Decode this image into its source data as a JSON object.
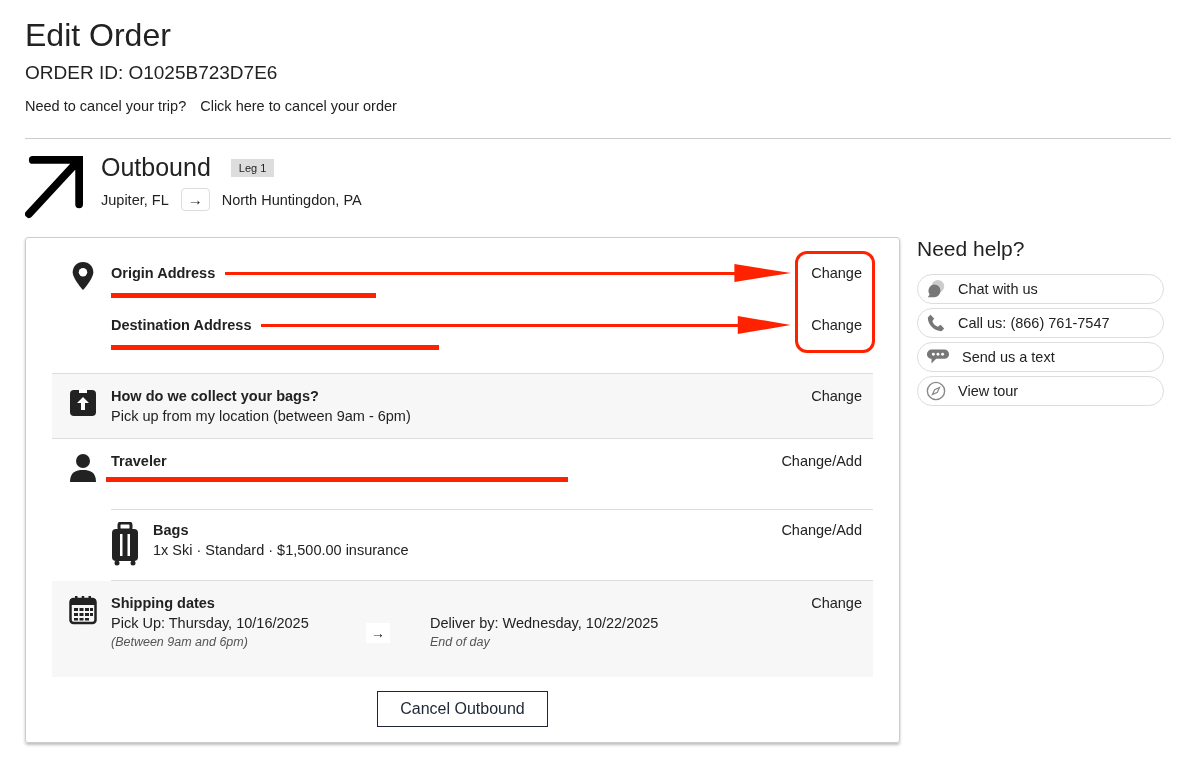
{
  "title": "Edit Order",
  "order_id": "ORDER ID: O1025B723D7E6",
  "cancel_prompt": {
    "question": "Need to cancel your trip?",
    "link": "Click here to cancel your order"
  },
  "leg": {
    "title": "Outbound",
    "badge": "Leg 1",
    "from": "Jupiter, FL",
    "arrow": "→",
    "to": "North Huntingdon, PA"
  },
  "addresses": [
    {
      "label": "Origin Address",
      "action": "Change"
    },
    {
      "label": "Destination Address",
      "action": "Change"
    }
  ],
  "sections": [
    {
      "kind": "collection",
      "title": "How do we collect your bags?",
      "detail": "Pick up from my location (between 9am - 6pm)",
      "action": "Change"
    },
    {
      "kind": "traveler",
      "title": "Traveler",
      "action": "Change/Add"
    },
    {
      "kind": "bags",
      "title": "Bags",
      "detail": "1x Ski · Standard · $1,500.00 insurance",
      "action": "Change/Add"
    },
    {
      "kind": "dates",
      "title": "Shipping dates",
      "pickup": "Pick Up: Thursday, 10/16/2025",
      "pickup_note": "(Between 9am and 6pm)",
      "arrow": "→",
      "deliver": "Deliver by: Wednesday, 10/22/2025",
      "deliver_note": "End of day",
      "action": "Change"
    }
  ],
  "cancel_button": "Cancel Outbound",
  "help": {
    "title": "Need help?",
    "items": [
      {
        "kind": "chat",
        "label": "Chat with us"
      },
      {
        "kind": "call",
        "label": "Call us: (866) 761-7547"
      },
      {
        "kind": "text",
        "label": "Send us a text"
      },
      {
        "kind": "tour",
        "label": "View tour"
      }
    ]
  }
}
